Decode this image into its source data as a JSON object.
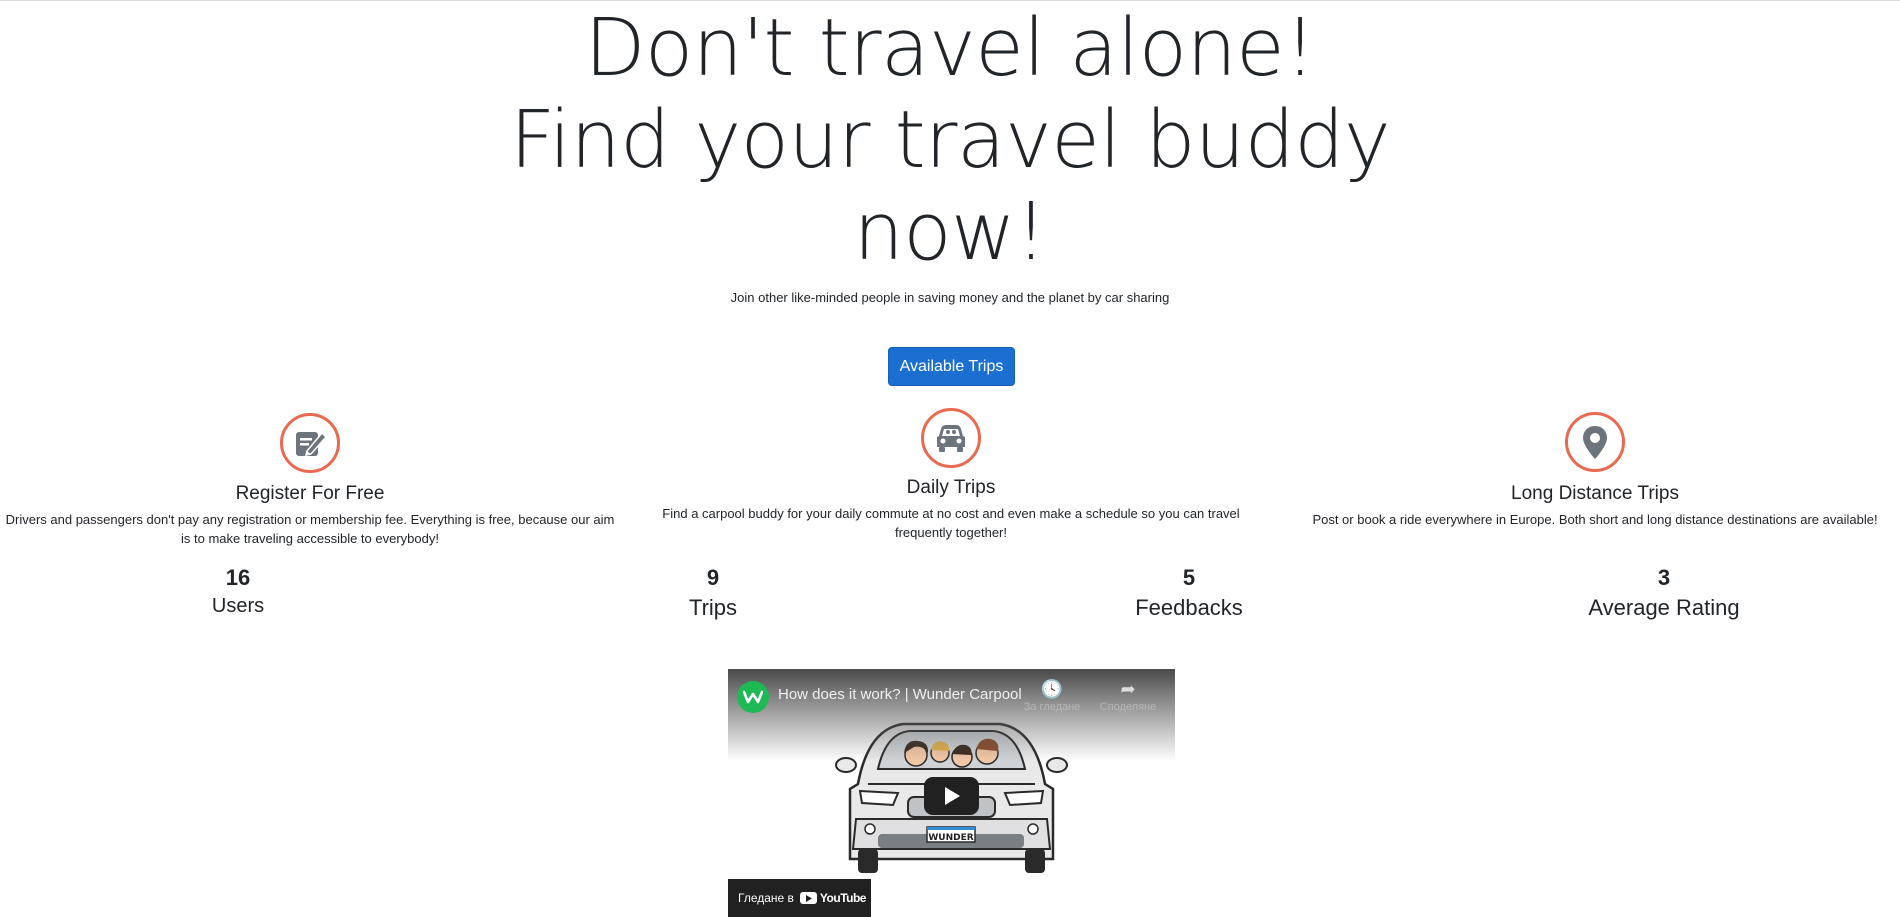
{
  "hero": {
    "line1": "Don't travel alone!",
    "line2": "Find your travel buddy",
    "line3": "now!",
    "subtitle": "Join other like-minded people in saving money and the planet by car sharing",
    "cta_label": "Available Trips"
  },
  "features": [
    {
      "icon": "edit-icon",
      "title": "Register For Free",
      "text": "Drivers and passengers don't pay any registration or membership fee. Everything is free, because our aim is to make traveling accessible to everybody!"
    },
    {
      "icon": "car-icon",
      "title": "Daily Trips",
      "text": "Find a carpool buddy for your daily commute at no cost and even make a schedule so you can travel frequently together!"
    },
    {
      "icon": "map-pin-icon",
      "title": "Long Distance Trips",
      "text": "Post or book a ride everywhere in Europe. Both short and long distance destinations are available!"
    }
  ],
  "stats": [
    {
      "value": "16",
      "label": "Users"
    },
    {
      "value": "9",
      "label": "Trips"
    },
    {
      "value": "5",
      "label": "Feedbacks"
    },
    {
      "value": "3",
      "label": "Average Rating"
    }
  ],
  "video": {
    "title": "How does it work? | Wunder Carpool",
    "watch_later": "За гледане",
    "share": "Споделяне",
    "watch_on": "Гледане в",
    "youtube": "YouTube",
    "plate": "WUNDER"
  },
  "colors": {
    "accent": "#e96a50",
    "button": "#1a6fd0",
    "icon_gray": "#6c757d",
    "text": "#212529"
  }
}
